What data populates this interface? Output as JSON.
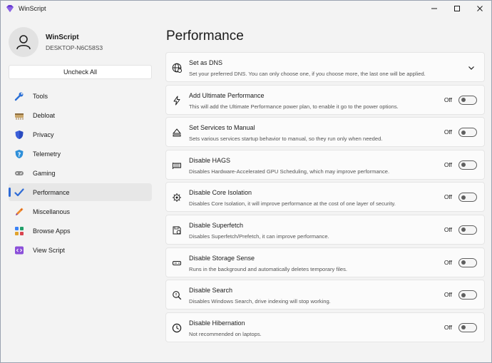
{
  "window": {
    "title": "WinScript"
  },
  "profile": {
    "name": "WinScript",
    "machine": "DESKTOP-N6C58S3"
  },
  "sidebar": {
    "uncheck_label": "Uncheck All",
    "items": [
      {
        "label": "Tools",
        "icon": "wrench-icon"
      },
      {
        "label": "Debloat",
        "icon": "broom-icon"
      },
      {
        "label": "Privacy",
        "icon": "shield-icon"
      },
      {
        "label": "Telemetry",
        "icon": "info-shield-icon"
      },
      {
        "label": "Gaming",
        "icon": "gamepad-icon"
      },
      {
        "label": "Performance",
        "icon": "checkmark-icon",
        "active": true
      },
      {
        "label": "Miscellanous",
        "icon": "pencil-icon"
      },
      {
        "label": "Browse Apps",
        "icon": "apps-icon"
      },
      {
        "label": "View Script",
        "icon": "code-icon"
      }
    ]
  },
  "main": {
    "title": "Performance",
    "off_label": "Off",
    "options": [
      {
        "title": "Set as DNS",
        "desc": "Set your preferred DNS. You can only choose one, if you choose more, the last one will be applied.",
        "icon": "globe-icon",
        "type": "expander"
      },
      {
        "title": "Add Ultimate Performance",
        "desc": "This will add the Ultimate Performance power plan, to enable it go to the power options.",
        "icon": "lightning-icon",
        "type": "toggle",
        "state": "Off"
      },
      {
        "title": "Set Services to Manual",
        "desc": "Sets various services startup behavior to manual, so they run only when needed.",
        "icon": "eject-icon",
        "type": "toggle",
        "state": "Off"
      },
      {
        "title": "Disable HAGS",
        "desc": "Disables Hardware-Accelerated GPU Scheduling, which may improve performance.",
        "icon": "gpu-icon",
        "type": "toggle",
        "state": "Off"
      },
      {
        "title": "Disable Core Isolation",
        "desc": "Disables Core Isolation, it will improve performance at the cost of one layer of security.",
        "icon": "cpu-gear-icon",
        "type": "toggle",
        "state": "Off"
      },
      {
        "title": "Disable Superfetch",
        "desc": "Disables Superfetch/Prefetch, it can improve performance.",
        "icon": "save-icon",
        "type": "toggle",
        "state": "Off"
      },
      {
        "title": "Disable Storage Sense",
        "desc": "Runs in the background and automatically deletes temporary files.",
        "icon": "drive-icon",
        "type": "toggle",
        "state": "Off"
      },
      {
        "title": "Disable Search",
        "desc": "Disables Windows Search, drive indexing will stop working.",
        "icon": "search-doc-icon",
        "type": "toggle",
        "state": "Off"
      },
      {
        "title": "Disable Hibernation",
        "desc": "Not recommended on laptops.",
        "icon": "clock-icon",
        "type": "toggle",
        "state": "Off"
      }
    ]
  }
}
